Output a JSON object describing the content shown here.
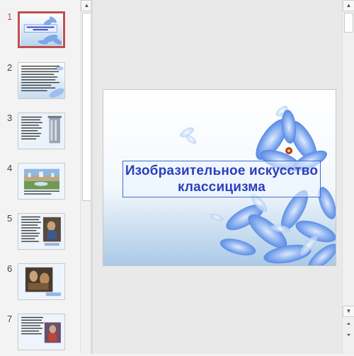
{
  "thumbnails": [
    {
      "number": "1",
      "selected": true,
      "caption": "Изобразительное искусство классицизма"
    },
    {
      "number": "2",
      "selected": false
    },
    {
      "number": "3",
      "selected": false
    },
    {
      "number": "4",
      "selected": false
    },
    {
      "number": "5",
      "selected": false
    },
    {
      "number": "6",
      "selected": false
    },
    {
      "number": "7",
      "selected": false
    }
  ],
  "slide": {
    "title": "Изобразительное искусство\nклассицизма"
  },
  "colors": {
    "selection": "#c0504d",
    "title_text": "#2a3fbd",
    "title_border": "#3f6fd1",
    "flower_blue": "#5b8de8"
  },
  "icons": {
    "scroll_up": "▲",
    "scroll_down": "▼",
    "prev_slide": "⏶",
    "next_slide": "⏷"
  }
}
